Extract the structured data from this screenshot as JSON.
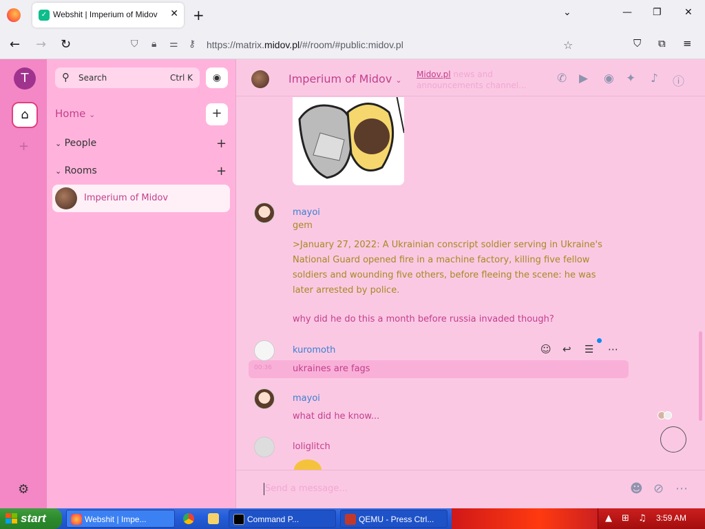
{
  "browser": {
    "tab_title": "Webshit | Imperium of Midov",
    "url_prefix": "https://matrix.",
    "url_domain": "midov.pl",
    "url_path": "/#/room/#public:midov.pl"
  },
  "spaces": {
    "user_initial": "T"
  },
  "roomlist": {
    "search_placeholder": "Search",
    "search_shortcut": "Ctrl K",
    "home_label": "Home",
    "sections": [
      "People",
      "Rooms"
    ],
    "rooms": [
      {
        "name": "Imperium of Midov"
      }
    ]
  },
  "room": {
    "name": "Imperium of Midov",
    "topic_link": "Midov.pl",
    "topic_rest": " news and announcements channel..."
  },
  "messages": [
    {
      "sender": "mayoi",
      "lines": [
        "gem"
      ]
    },
    {
      "sender": "mayoi",
      "quote": ">January 27, 2022: A Ukrainian conscript soldier serving in Ukraine's National Guard opened fire in a machine factory, killing five fellow soldiers and wounding five others, before fleeing the scene: he was later arrested by police.",
      "followup": "why did he do this a month before russia invaded though?"
    },
    {
      "sender": "kuromoth",
      "text": "ukraines are fags",
      "time": "00:36"
    },
    {
      "sender": "mayoi",
      "text": "what did he know..."
    },
    {
      "sender": "loliglitch",
      "text": ""
    }
  ],
  "composer": {
    "placeholder": "Send a message..."
  },
  "taskbar": {
    "start_label": "start",
    "tasks": [
      {
        "label": "Webshit | Impe..."
      },
      {
        "label": "Command P..."
      },
      {
        "label": "QEMU - Press Ctrl..."
      }
    ],
    "clock": "3:59 AM"
  },
  "colors": {
    "spaces_bg": "#f487c5",
    "roomlist_bg": "#ffb3dc",
    "main_bg": "#fbc8e4",
    "accent": "#c23f8b",
    "username_blue": "#3b7fcf",
    "quote_green": "#a68a1f"
  }
}
